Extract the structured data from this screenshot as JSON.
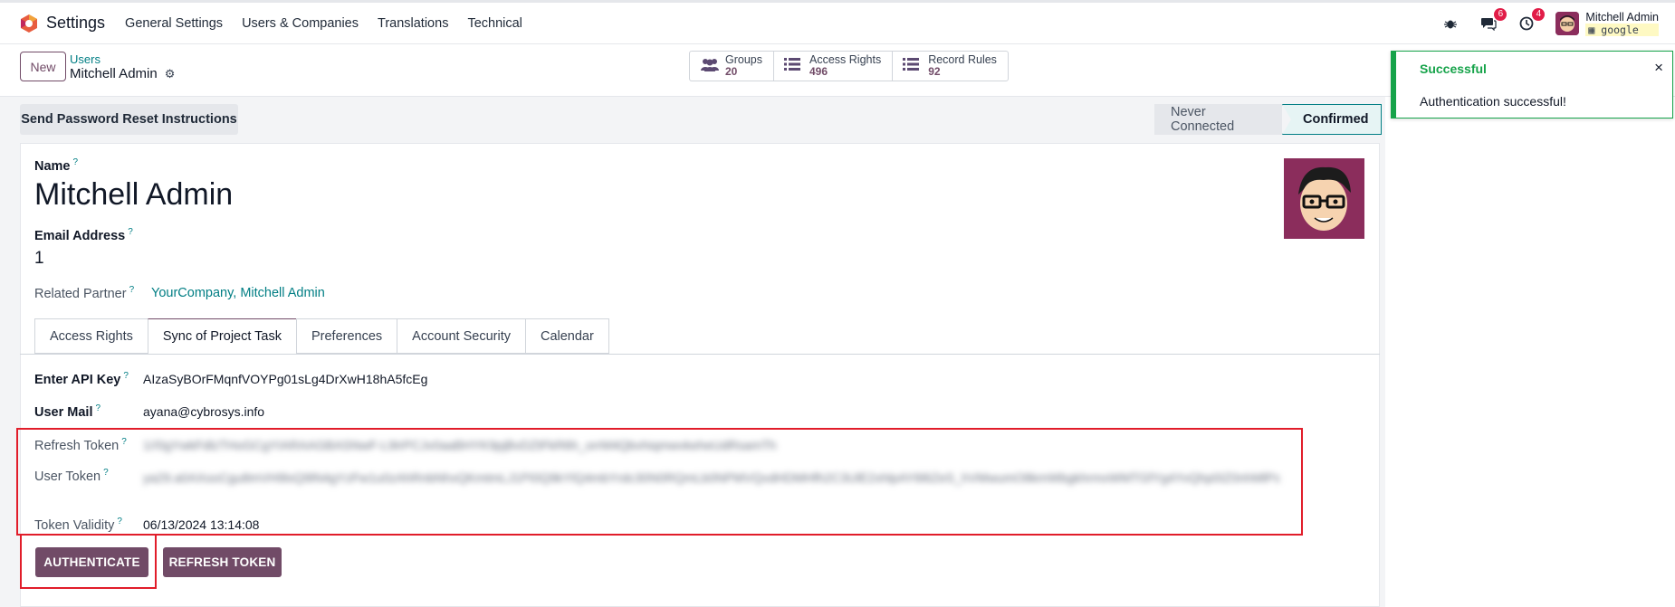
{
  "topnav": {
    "app_title": "Settings",
    "menu": [
      "General Settings",
      "Users & Companies",
      "Translations",
      "Technical"
    ],
    "messages_badge": "6",
    "activities_badge": "4",
    "user_name": "Mitchell Admin",
    "database": "google"
  },
  "control_panel": {
    "new_label": "New",
    "breadcrumb_parent": "Users",
    "breadcrumb_current": "Mitchell Admin",
    "smart_buttons": [
      {
        "label": "Groups",
        "value": "20",
        "icon": "users-icon"
      },
      {
        "label": "Access Rights",
        "value": "496",
        "icon": "list-icon"
      },
      {
        "label": "Record Rules",
        "value": "92",
        "icon": "list-icon"
      }
    ]
  },
  "header": {
    "reset_button": "Send Password Reset Instructions",
    "status_never": "Never Connected",
    "status_confirmed": "Confirmed"
  },
  "form": {
    "name_label": "Name",
    "name_value": "Mitchell Admin",
    "email_label": "Email Address",
    "email_value": "1",
    "partner_label": "Related Partner",
    "partner_value": "YourCompany, Mitchell Admin",
    "help_mark": "?"
  },
  "tabs": [
    "Access Rights",
    "Sync of Project Task",
    "Preferences",
    "Account Security",
    "Calendar"
  ],
  "sync_tab": {
    "api_key_label": "Enter API Key",
    "api_key_value": "AIzaSyBOrFMqnfVOYPg01sLg4DrXwH18hA5fcEg",
    "user_mail_label": "User Mail",
    "user_mail_value": "ayana@cybrosys.info",
    "refresh_token_label": "Refresh Token",
    "user_token_label": "User Token",
    "token_validity_label": "Token Validity",
    "token_validity_value": "06/13/2024 13:14:08",
    "authenticate_button": "AUTHENTICATE",
    "refresh_button": "REFRESH TOKEN"
  },
  "toast": {
    "title": "Successful",
    "message": "Authentication successful!",
    "close": "×"
  },
  "colors": {
    "brand": "#714b67",
    "link": "#017e84",
    "success": "#16a34a",
    "highlight": "#e11d2a"
  }
}
